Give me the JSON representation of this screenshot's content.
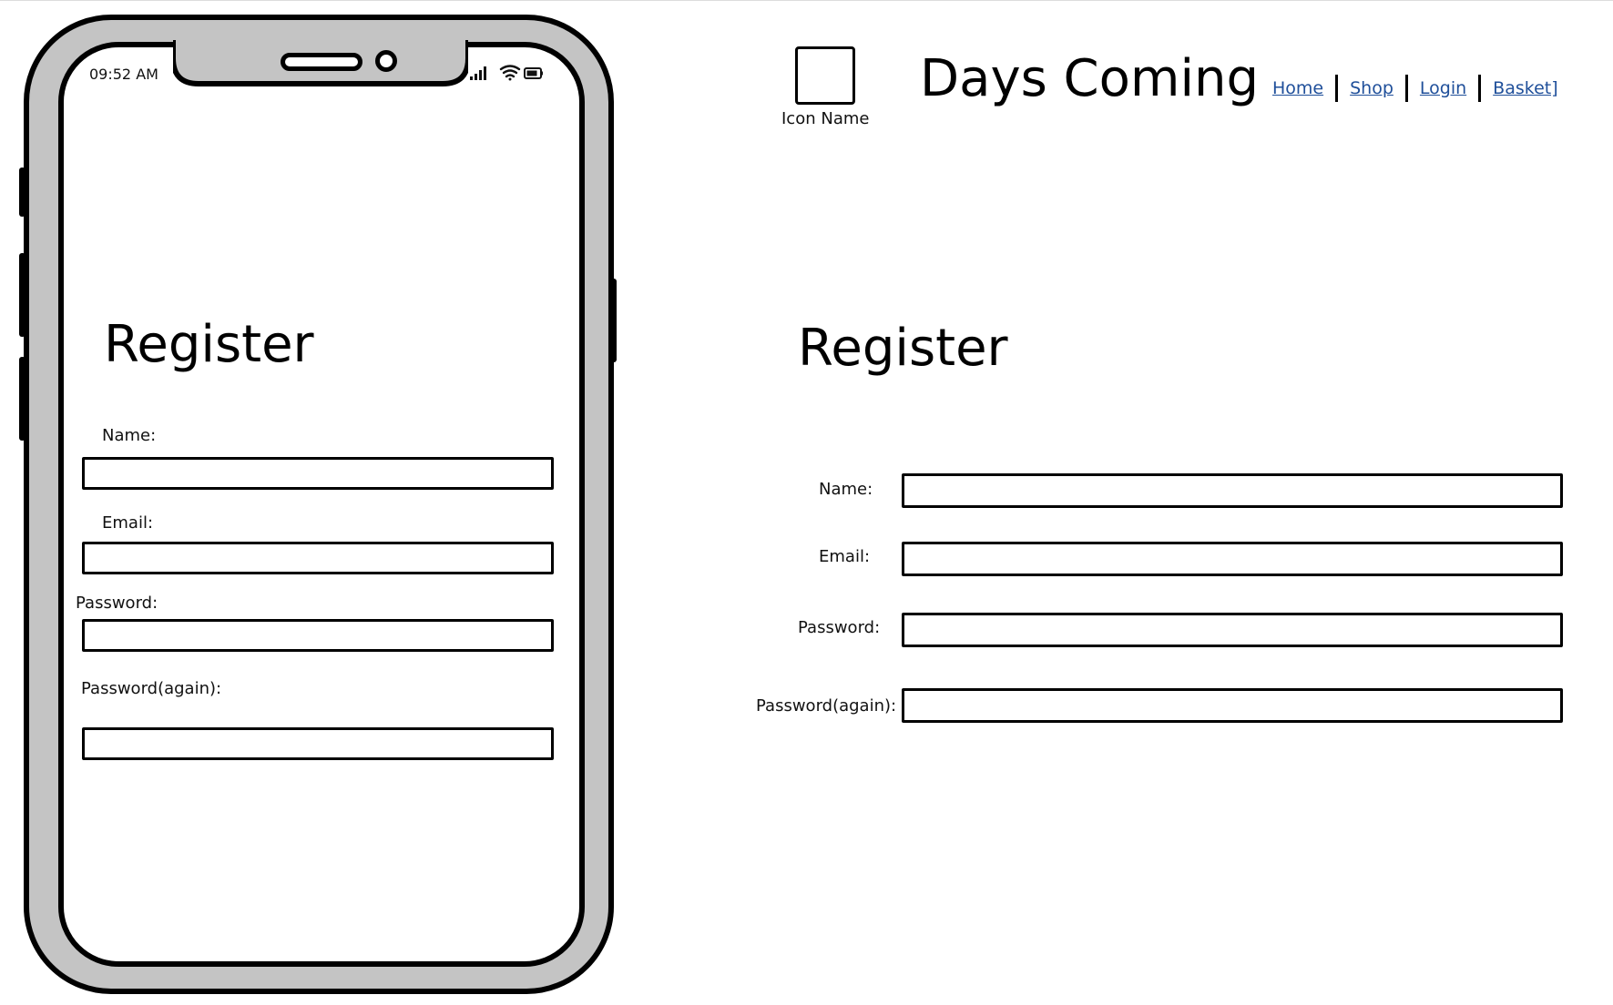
{
  "mobile": {
    "status_time": "09:52 AM",
    "status_icons": [
      "signal-icon",
      "wifi-icon",
      "battery-icon"
    ],
    "title": "Register",
    "fields": [
      {
        "label": "Name:",
        "value": ""
      },
      {
        "label": "Email:",
        "value": ""
      },
      {
        "label": "Password:",
        "value": ""
      },
      {
        "label": "Password(again):",
        "value": ""
      }
    ]
  },
  "desktop": {
    "logo": {
      "icon": "image-placeholder-icon",
      "caption": "Icon Name"
    },
    "site_title": "Days Coming",
    "nav": [
      "Home",
      "Shop",
      "Login",
      "Basket]"
    ],
    "title": "Register",
    "fields": [
      {
        "label": "Name:",
        "value": ""
      },
      {
        "label": "Email:",
        "value": ""
      },
      {
        "label": "Password:",
        "value": ""
      },
      {
        "label": "Password(again):",
        "value": ""
      }
    ]
  },
  "colors": {
    "link": "#1f4f9a",
    "phone_frame": "#c4c4c4",
    "outline": "#000000"
  }
}
